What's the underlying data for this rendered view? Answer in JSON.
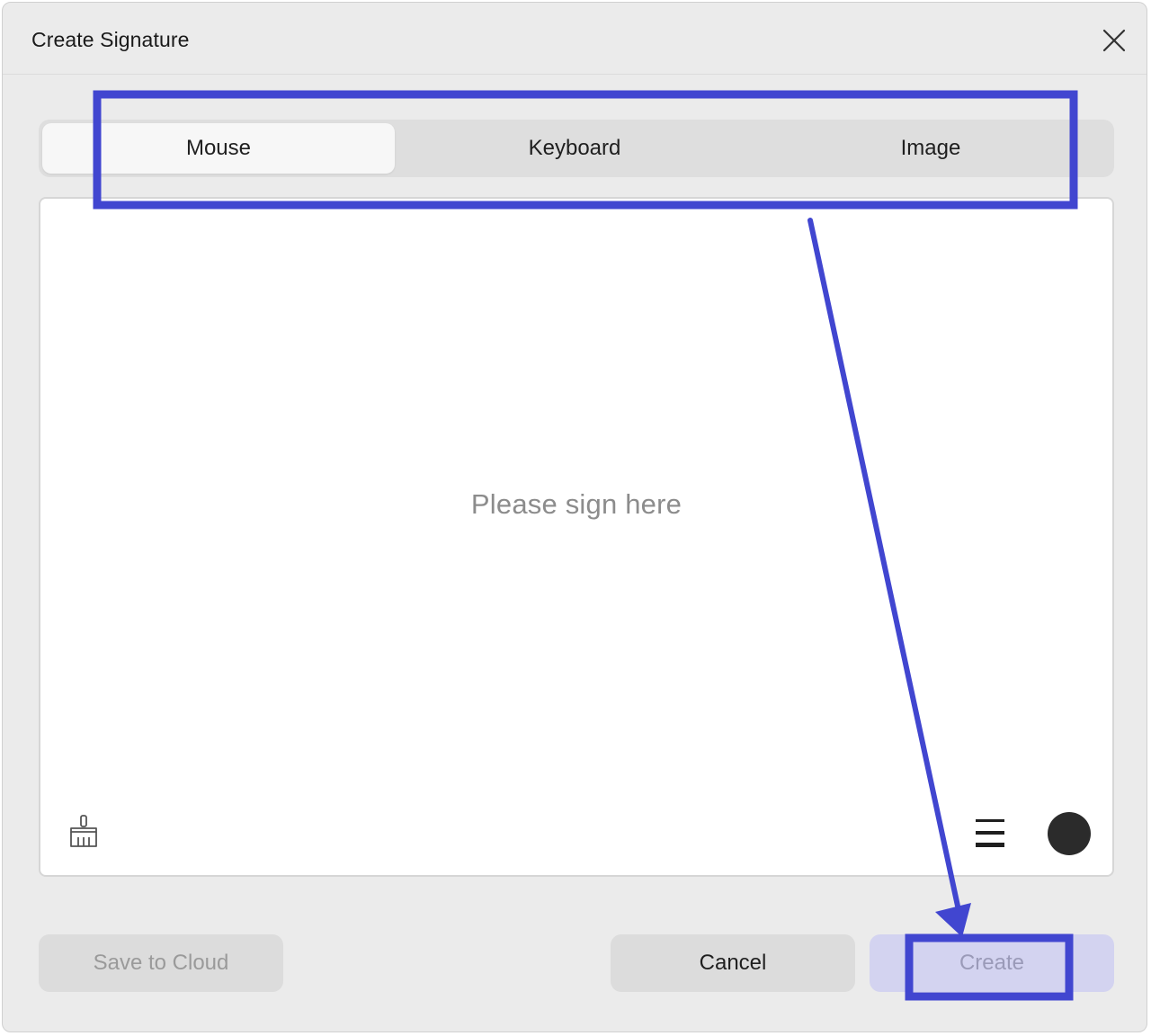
{
  "dialog": {
    "title": "Create Signature",
    "close_icon": "close-icon"
  },
  "tabs": [
    {
      "label": "Mouse",
      "active": true
    },
    {
      "label": "Keyboard",
      "active": false
    },
    {
      "label": "Image",
      "active": false
    }
  ],
  "sign_area": {
    "placeholder": "Please sign here",
    "clear_icon": "brush-icon",
    "thickness_icon": "line-thickness-icon",
    "pen_color": "#2b2b2b"
  },
  "buttons": {
    "save_to_cloud": "Save to Cloud",
    "cancel": "Cancel",
    "create": "Create"
  },
  "annotation": {
    "color": "#4146d0"
  }
}
